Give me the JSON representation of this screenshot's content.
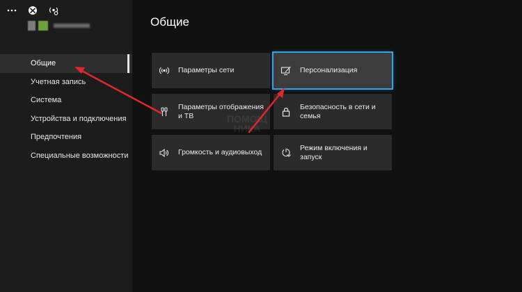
{
  "page": {
    "title": "Общие"
  },
  "sidebar": {
    "items": [
      {
        "label": "Общие",
        "active": true
      },
      {
        "label": "Учетная запись",
        "active": false
      },
      {
        "label": "Система",
        "active": false
      },
      {
        "label": "Устройства и подключения",
        "active": false
      },
      {
        "label": "Предпочтения",
        "active": false
      },
      {
        "label": "Специальные возможности",
        "active": false
      }
    ]
  },
  "tiles": [
    {
      "label": "Параметры сети",
      "icon": "network-icon"
    },
    {
      "label": "Персонализация",
      "icon": "personalization-icon",
      "focused": true
    },
    {
      "label": "Параметры отображения и ТВ",
      "icon": "display-tv-icon"
    },
    {
      "label": "Безопасность в сети и семья",
      "icon": "lock-icon"
    },
    {
      "label": "Громкость и аудиовыход",
      "icon": "speaker-icon"
    },
    {
      "label": "Режим включения и запуск",
      "icon": "power-icon"
    }
  ],
  "watermark": {
    "line1": "ПОМОЩ",
    "line2": "НИКА"
  },
  "colors": {
    "background": "#111111",
    "sidebar": "#1c1c1c",
    "tile": "#2b2b2b",
    "focus": "#3aa0e6",
    "arrow": "#e0282c"
  }
}
